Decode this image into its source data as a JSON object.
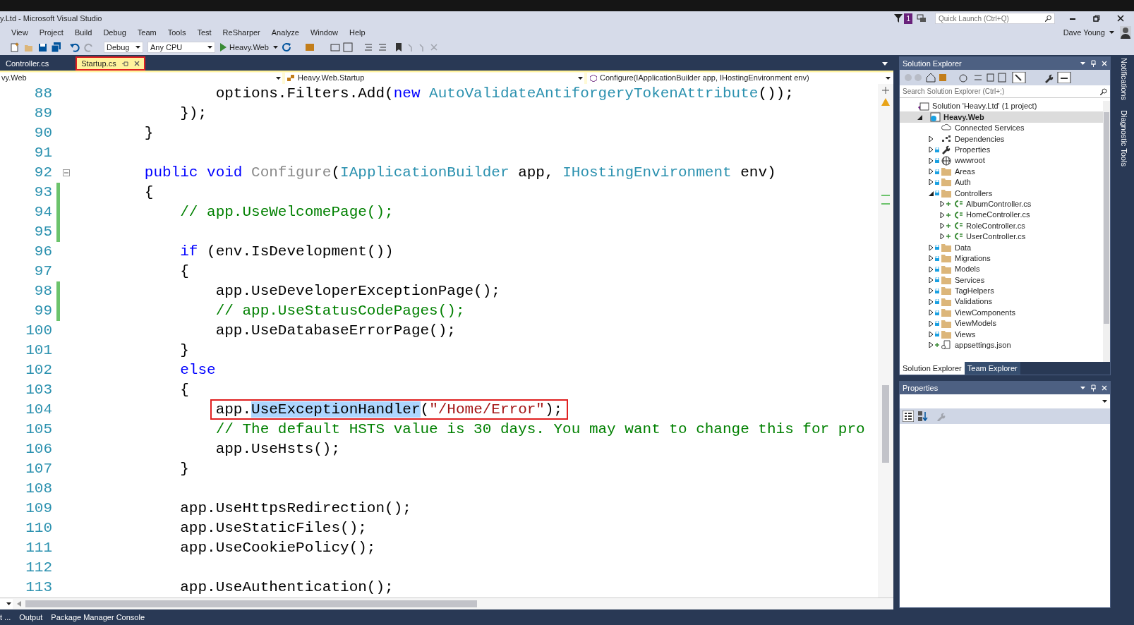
{
  "window": {
    "title": "y.Ltd - Microsoft Visual Studio",
    "notification_count": "1",
    "quick_launch": {
      "placeholder": "Quick Launch (Ctrl+Q)"
    },
    "user": "Dave Young"
  },
  "menu": [
    "View",
    "Project",
    "Build",
    "Debug",
    "Team",
    "Tools",
    "Test",
    "ReSharper",
    "Analyze",
    "Window",
    "Help"
  ],
  "toolbar": {
    "configuration": "Debug",
    "platform": "Any CPU",
    "start_project": "Heavy.Web"
  },
  "tabs": [
    {
      "label": "Controller.cs",
      "selected": false,
      "boxed": false
    },
    {
      "label": "Startup.cs",
      "selected": true,
      "boxed": true
    }
  ],
  "navigation": {
    "project": "vy.Web",
    "type": "Heavy.Web.Startup",
    "member": "Configure(IApplicationBuilder app, IHostingEnvironment env)"
  },
  "code_lines": [
    {
      "number": "88",
      "changed": false,
      "tokens": [
        {
          "kind": "plain",
          "text": "                options.Filters.Add("
        },
        {
          "kind": "keyword",
          "text": "new"
        },
        {
          "kind": "type",
          "text": " AutoValidateAntiforgeryTokenAttribute"
        },
        {
          "kind": "plain",
          "text": "());"
        }
      ]
    },
    {
      "number": "89",
      "changed": false,
      "tokens": [
        {
          "kind": "plain",
          "text": "            });"
        }
      ]
    },
    {
      "number": "90",
      "changed": false,
      "tokens": [
        {
          "kind": "plain",
          "text": "        }"
        }
      ]
    },
    {
      "number": "91",
      "changed": false
    },
    {
      "number": "92",
      "changed": false,
      "collapsible": true,
      "tokens": [
        {
          "kind": "keyword",
          "text": "        public void"
        },
        {
          "kind": "unused",
          "text": " Configure"
        },
        {
          "kind": "plain",
          "text": "("
        },
        {
          "kind": "type",
          "text": "IApplicationBuilder"
        },
        {
          "kind": "plain",
          "text": " app, "
        },
        {
          "kind": "type",
          "text": "IHostingEnvironment"
        },
        {
          "kind": "plain",
          "text": " env)"
        }
      ]
    },
    {
      "number": "93",
      "changed": true,
      "tokens": [
        {
          "kind": "plain",
          "text": "        {"
        }
      ]
    },
    {
      "number": "94",
      "changed": true,
      "tokens": [
        {
          "kind": "comment",
          "text": "            // app.UseWelcomePage();"
        }
      ]
    },
    {
      "number": "95",
      "changed": true
    },
    {
      "number": "96",
      "changed": false,
      "tokens": [
        {
          "kind": "keyword",
          "text": "            if"
        },
        {
          "kind": "plain",
          "text": " (env.IsDevelopment())"
        }
      ]
    },
    {
      "number": "97",
      "changed": false,
      "tokens": [
        {
          "kind": "plain",
          "text": "            {"
        }
      ]
    },
    {
      "number": "98",
      "changed": true,
      "tokens": [
        {
          "kind": "plain",
          "text": "                app.UseDeveloperExceptionPage();"
        }
      ]
    },
    {
      "number": "99",
      "changed": true,
      "tokens": [
        {
          "kind": "comment",
          "text": "                // app.UseStatusCodePages();"
        }
      ]
    },
    {
      "number": "100",
      "changed": false,
      "tokens": [
        {
          "kind": "plain",
          "text": "                app.UseDatabaseErrorPage();"
        }
      ]
    },
    {
      "number": "101",
      "changed": false,
      "tokens": [
        {
          "kind": "plain",
          "text": "            }"
        }
      ]
    },
    {
      "number": "102",
      "changed": false,
      "tokens": [
        {
          "kind": "keyword",
          "text": "            else"
        }
      ]
    },
    {
      "number": "103",
      "changed": false,
      "tokens": [
        {
          "kind": "plain",
          "text": "            {"
        }
      ]
    },
    {
      "number": "104",
      "changed": false,
      "boxed": true,
      "tokens": [
        {
          "kind": "plain",
          "text": "                app."
        },
        {
          "kind": "selected",
          "text": "UseExceptionHandler"
        },
        {
          "kind": "plain",
          "text": "("
        },
        {
          "kind": "string",
          "text": "\"/Home/Error\""
        },
        {
          "kind": "plain",
          "text": ");"
        }
      ]
    },
    {
      "number": "105",
      "changed": false,
      "tokens": [
        {
          "kind": "comment",
          "text": "                // The default HSTS value is 30 days. You may want to change this for pro"
        }
      ]
    },
    {
      "number": "106",
      "changed": false,
      "tokens": [
        {
          "kind": "plain",
          "text": "                app.UseHsts();"
        }
      ]
    },
    {
      "number": "107",
      "changed": false,
      "tokens": [
        {
          "kind": "plain",
          "text": "            }"
        }
      ]
    },
    {
      "number": "108",
      "changed": false
    },
    {
      "number": "109",
      "changed": false,
      "tokens": [
        {
          "kind": "plain",
          "text": "            app.UseHttpsRedirection();"
        }
      ]
    },
    {
      "number": "110",
      "changed": false,
      "tokens": [
        {
          "kind": "plain",
          "text": "            app.UseStaticFiles();"
        }
      ]
    },
    {
      "number": "111",
      "changed": false,
      "tokens": [
        {
          "kind": "plain",
          "text": "            app.UseCookiePolicy();"
        }
      ]
    },
    {
      "number": "112",
      "changed": false
    },
    {
      "number": "113",
      "changed": false,
      "tokens": [
        {
          "kind": "plain",
          "text": "            app.UseAuthentication();"
        }
      ]
    }
  ],
  "solution_explorer": {
    "title": "Solution Explorer",
    "search": {
      "placeholder": "Search Solution Explorer (Ctrl+;)"
    },
    "tree": [
      {
        "name": "Solution 'Heavy.Ltd' (1 project)",
        "kind": "solution",
        "selected": false,
        "children": [
          {
            "name": "Heavy.Web",
            "kind": "project",
            "expanded": true,
            "selected": true,
            "children": [
              {
                "name": "Connected Services",
                "kind": "service",
                "selected": false
              },
              {
                "name": "Dependencies",
                "kind": "dependencies",
                "expanded": false,
                "selected": false
              },
              {
                "name": "Properties",
                "kind": "properties",
                "expanded": false,
                "selected": false
              },
              {
                "name": "wwwroot",
                "kind": "globe",
                "expanded": false,
                "selected": false
              },
              {
                "name": "Areas",
                "kind": "folder",
                "expanded": false,
                "selected": false
              },
              {
                "name": "Auth",
                "kind": "folder",
                "expanded": false,
                "selected": false
              },
              {
                "name": "Controllers",
                "kind": "folder",
                "expanded": true,
                "selected": false,
                "children": [
                  {
                    "name": "AlbumController.cs",
                    "kind": "csfile",
                    "expanded": false,
                    "selected": false
                  },
                  {
                    "name": "HomeController.cs",
                    "kind": "csfile",
                    "expanded": false,
                    "selected": false
                  },
                  {
                    "name": "RoleController.cs",
                    "kind": "csfile",
                    "expanded": false,
                    "selected": false
                  },
                  {
                    "name": "UserController.cs",
                    "kind": "csfile",
                    "expanded": false,
                    "selected": false
                  }
                ]
              },
              {
                "name": "Data",
                "kind": "folder",
                "expanded": false,
                "selected": false
              },
              {
                "name": "Migrations",
                "kind": "folder",
                "expanded": false,
                "selected": false
              },
              {
                "name": "Models",
                "kind": "folder",
                "expanded": false,
                "selected": false
              },
              {
                "name": "Services",
                "kind": "folder",
                "expanded": false,
                "selected": false
              },
              {
                "name": "TagHelpers",
                "kind": "folder",
                "expanded": false,
                "selected": false
              },
              {
                "name": "Validations",
                "kind": "folder",
                "expanded": false,
                "selected": false
              },
              {
                "name": "ViewComponents",
                "kind": "folder",
                "expanded": false,
                "selected": false
              },
              {
                "name": "ViewModels",
                "kind": "folder",
                "expanded": false,
                "selected": false
              },
              {
                "name": "Views",
                "kind": "folder",
                "expanded": false,
                "selected": false
              },
              {
                "name": "appsettings.json",
                "kind": "json",
                "expanded": false,
                "selected": false
              }
            ]
          }
        ]
      }
    ],
    "tabs": [
      {
        "label": "Solution Explorer",
        "selected": true
      },
      {
        "label": "Team Explorer",
        "selected": false
      }
    ]
  },
  "properties": {
    "title": "Properties"
  },
  "side_tabs": [
    "Notifications",
    "Diagnostic Tools"
  ],
  "bottom_tabs": [
    "t ...",
    "Output",
    "Package Manager Console"
  ]
}
